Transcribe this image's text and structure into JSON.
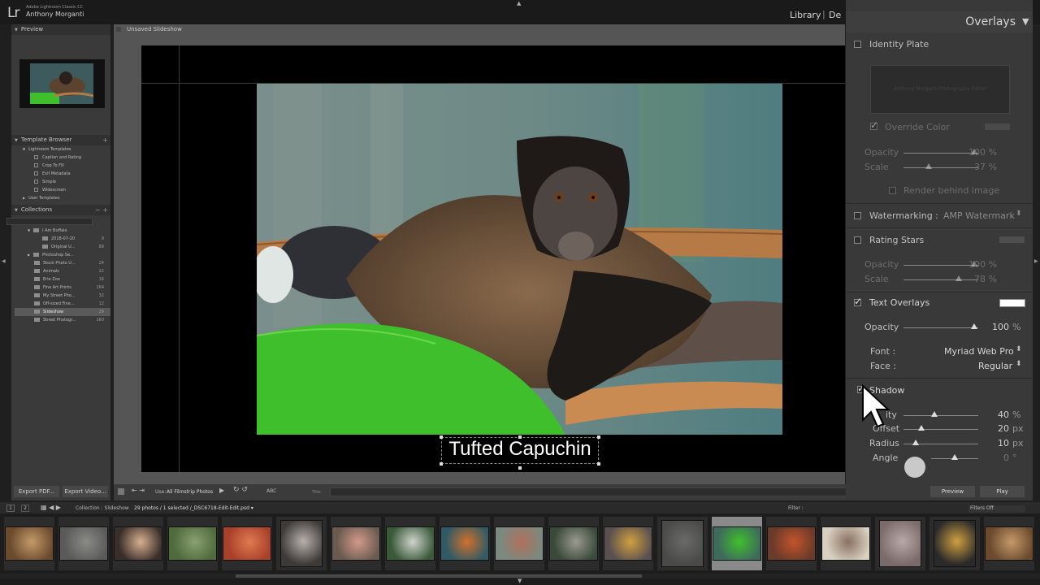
{
  "app": {
    "logo": "Lr",
    "product": "Adobe Lightroom Classic CC",
    "user": "Anthony Morganti",
    "modules": [
      "Library",
      "|",
      "De"
    ]
  },
  "left_panel": {
    "preview_header": "Preview",
    "template_header": "Template Browser",
    "templates": {
      "folder": "Lightroom Templates",
      "items": [
        "Caption and Rating",
        "Crop To Fill",
        "Exif Metadata",
        "Simple",
        "Widescreen"
      ],
      "user_folder": "User Templates"
    },
    "collections_header": "Collections",
    "collections": [
      {
        "label": "I Am Buffalo",
        "count": ""
      },
      {
        "label": "2018-07-20",
        "count": "9"
      },
      {
        "label": "Original U...",
        "count": "89"
      },
      {
        "label": "Photoshop Se...",
        "count": ""
      },
      {
        "label": "Stock Photo U...",
        "count": "24"
      },
      {
        "label": "Animals",
        "count": "22"
      },
      {
        "label": "Erie Zoo",
        "count": "16"
      },
      {
        "label": "Fine Art Prints",
        "count": "164"
      },
      {
        "label": "My Street Pho...",
        "count": "32"
      },
      {
        "label": "Off-sized Fine...",
        "count": "12"
      },
      {
        "label": "Slideshow",
        "count": "29"
      },
      {
        "label": "Street Photogr...",
        "count": "160"
      }
    ],
    "export_pdf": "Export PDF...",
    "export_video": "Export Video..."
  },
  "center": {
    "doc_title": "Unsaved Slideshow",
    "caption": "Tufted Capuchin"
  },
  "toolbar": {
    "use_label": "Use:",
    "use_value": "All Filmstrip Photos",
    "abc": "ABC",
    "title_label": "Title"
  },
  "right_panel": {
    "section_title": "Overlays",
    "identity_plate": "Identity Plate",
    "identity_plate_text": "Anthony Morganti  Photography Editor",
    "override_color": "Override Color",
    "opacity_label": "Opacity",
    "scale_label": "Scale",
    "identity_opacity": "100 %",
    "identity_scale": "37 %",
    "render_behind": "Render behind image",
    "watermarking": "Watermarking :",
    "watermark_value": "AMP Watermark",
    "rating_stars": "Rating Stars",
    "rating_opacity": "100 %",
    "rating_scale": "78 %",
    "text_overlays": "Text Overlays",
    "text_opacity_label": "Opacity",
    "text_opacity": "100",
    "pct": "%",
    "font_label": "Font :",
    "font_value": "Myriad Web Pro",
    "face_label": "Face :",
    "face_value": "Regular",
    "shadow": "Shadow",
    "shadow_opacity_label": "ity",
    "shadow_opacity": "40",
    "offset_label": "Offset",
    "offset_value": "20",
    "radius_label": "Radius",
    "radius_value": "10",
    "angle_label": "Angle",
    "angle_value": "0",
    "px": "px",
    "deg": "°",
    "preview_btn": "Preview",
    "play_btn": "Play"
  },
  "filmstrip": {
    "pages": [
      "1",
      "2"
    ],
    "source": "Collection : Slideshow",
    "count": "29 photos / 1 selected /_DSC6718-Edit-Edit.psd ▾",
    "filter_label": "Filter :",
    "filter_value": "Filters Off",
    "thumbnails": 19,
    "selected_index": 13
  },
  "colors": {
    "panel_bg": "#393939",
    "slide_bg": "#000000",
    "accent_text": "#ffffff"
  }
}
